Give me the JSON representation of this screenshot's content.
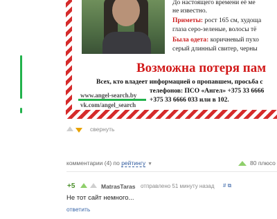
{
  "poster": {
    "line1": "До настоящего времени её ме",
    "line2": "не известно.",
    "signs_label": "Приметы:",
    "signs_text": " рост 165 см, худоща",
    "signs_line2": "глаза серо-зеленые, волосы тё",
    "clothes_label": "Была одета:",
    "clothes_text": " коричневый пухо",
    "clothes_line2": "серый длинный свитер, черны",
    "warning_title": "Возможна потеря пам",
    "info_line1": "Всех, кто владеет информацией о пропавшем, просьба с",
    "info_line2": "телефонов:  ПСО «Ангел»  +375  33 6666",
    "info_line3": "+375  33  6666  033  или  в  102.",
    "url1": "www.angel-search.by",
    "url2": "vk.com/angel_search"
  },
  "post_actions": {
    "collapse_label": "свернуть"
  },
  "comments": {
    "header_prefix": "комментарии (4) по ",
    "sort_label": "рейтингу",
    "pluses_label": "80 плюсо",
    "items": [
      {
        "score": "+5",
        "author": "MatrasTaras",
        "meta": "отправлено 51 минуту назад",
        "icons": "#  ⧉",
        "text": "Не тот сайт немного...",
        "reply_label": "ответить"
      }
    ]
  },
  "colors": {
    "accent_green": "#22b24c",
    "poster_red": "#d21b1b",
    "link_blue": "#3a66a8",
    "vote_down": "#e8a200"
  }
}
